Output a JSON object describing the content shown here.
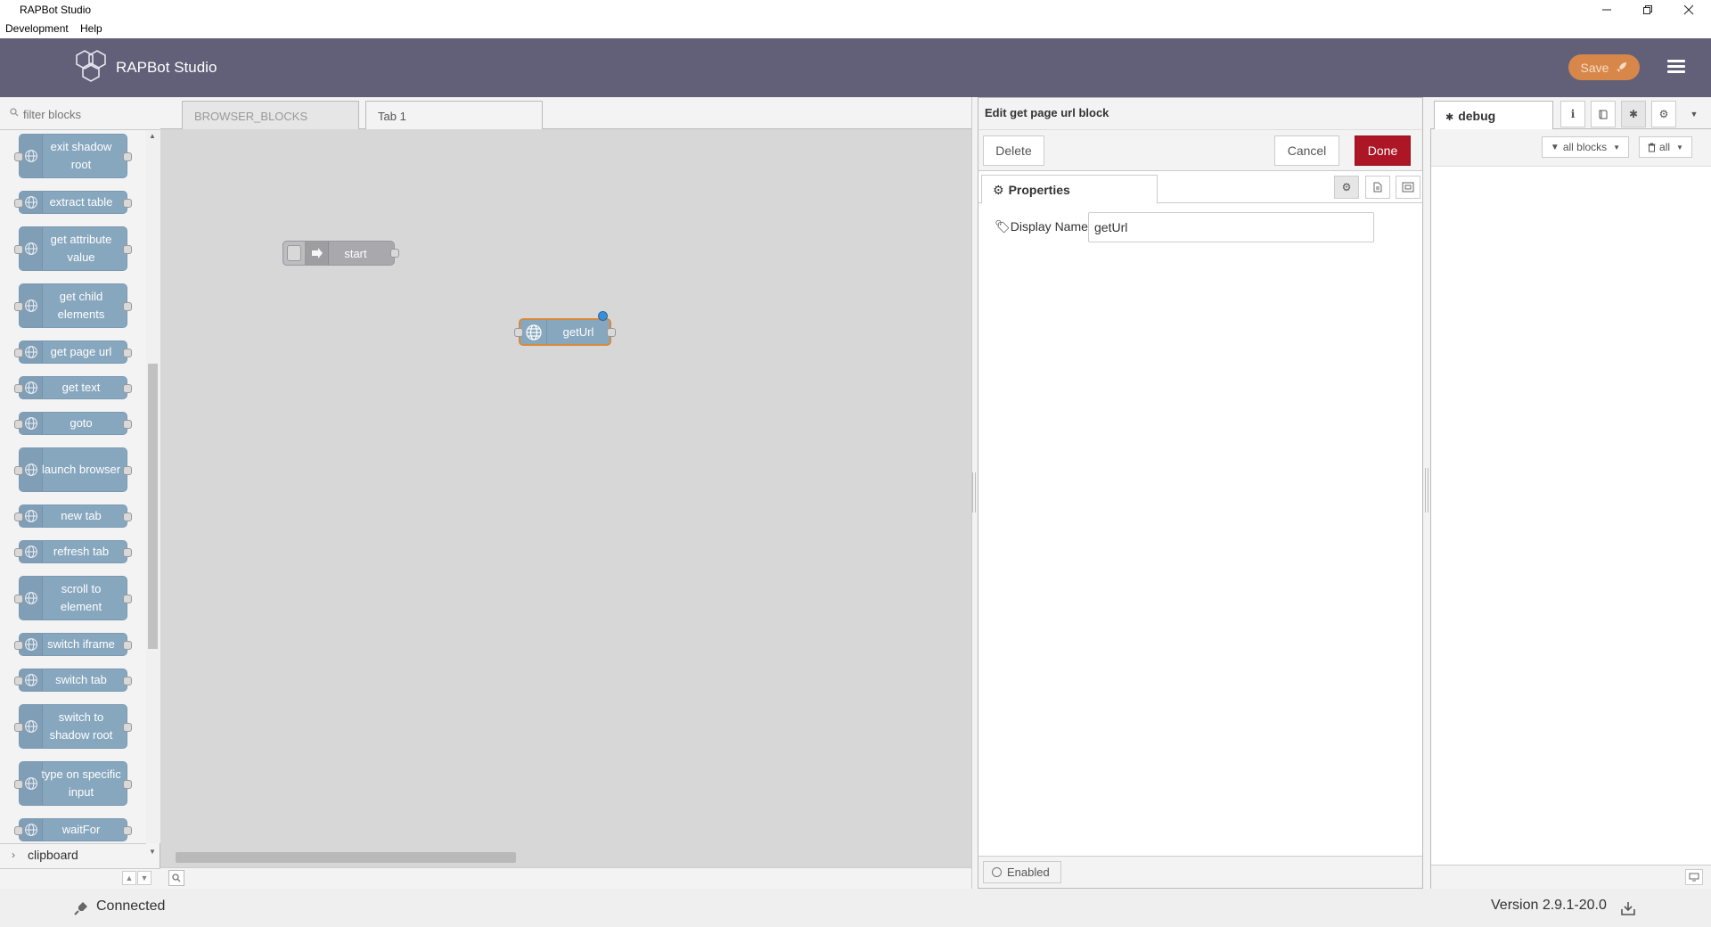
{
  "window": {
    "title": "RAPBot Studio",
    "minimize_icon": "minimize-icon",
    "restore_icon": "restore-icon",
    "close_icon": "close-icon"
  },
  "menubar": {
    "items": [
      "Development",
      "Help"
    ]
  },
  "header": {
    "app_name": "RAPBot Studio",
    "save_label": "Save",
    "brand_color": "#625f78",
    "save_color": "#d8874b"
  },
  "palette": {
    "filter_placeholder": "filter blocks",
    "nodes": [
      "exit shadow root",
      "extract table",
      "get attribute value",
      "get child elements",
      "get page url",
      "get text",
      "goto",
      "launch browser",
      "new tab",
      "refresh tab",
      "scroll to element",
      "switch iframe",
      "switch tab",
      "switch to shadow root",
      "type on specific input",
      "waitFor"
    ],
    "category": "clipboard",
    "node_color": "#87a7bf"
  },
  "workspace": {
    "tabs": [
      "BROWSER_BLOCKS",
      "Tab 1"
    ],
    "active_tab": "Tab 1",
    "nodes": {
      "start": "start",
      "geturl": "getUrl"
    }
  },
  "tray": {
    "title": "Edit get page url block",
    "delete_label": "Delete",
    "cancel_label": "Cancel",
    "done_label": "Done",
    "properties_tab": "Properties",
    "display_name_label": "Display Name",
    "display_name_value": "getUrl",
    "enabled_label": "Enabled",
    "done_color": "#ad1625"
  },
  "sidebar": {
    "debug_tab": "debug",
    "filter_label": "all blocks",
    "clear_label": "all"
  },
  "status": {
    "connection": "Connected",
    "version": "Version 2.9.1-20.0"
  }
}
